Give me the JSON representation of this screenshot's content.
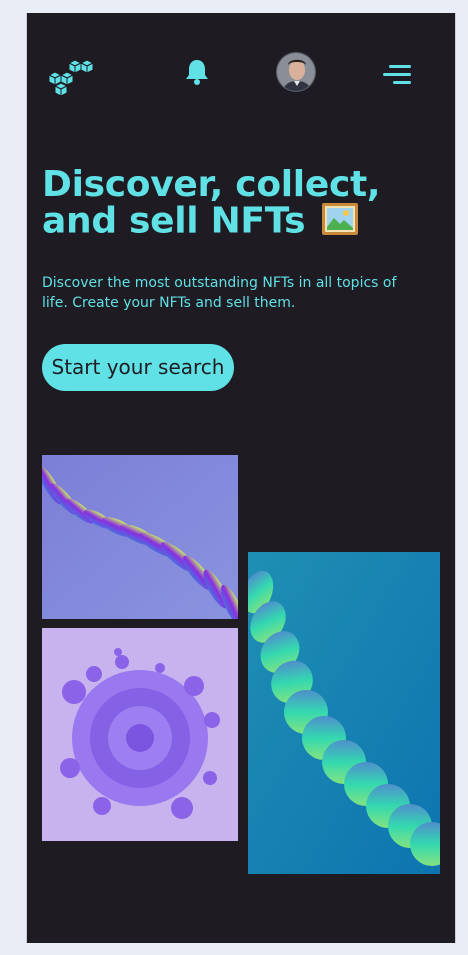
{
  "header": {
    "logo_icon": "cubes-logo-icon",
    "notification_icon": "bell-icon",
    "avatar_icon": "user-avatar",
    "menu_icon": "hamburger-menu-icon",
    "accent_color": "#5fe1e6",
    "background_color": "#1e1c22"
  },
  "hero": {
    "title": "Discover, collect, and sell NFTs",
    "title_icon": "framed-picture-icon",
    "description": "Discover the most outstanding NFTs in all topics of life. Create your NFTs and sell them.",
    "cta_label": "Start your search"
  },
  "gallery": {
    "images": [
      {
        "name": "purple-wave-art",
        "description_icon": "abstract-art-image"
      },
      {
        "name": "purple-spiral-art",
        "description_icon": "abstract-art-image"
      },
      {
        "name": "teal-wave-art",
        "description_icon": "abstract-art-image"
      }
    ]
  }
}
